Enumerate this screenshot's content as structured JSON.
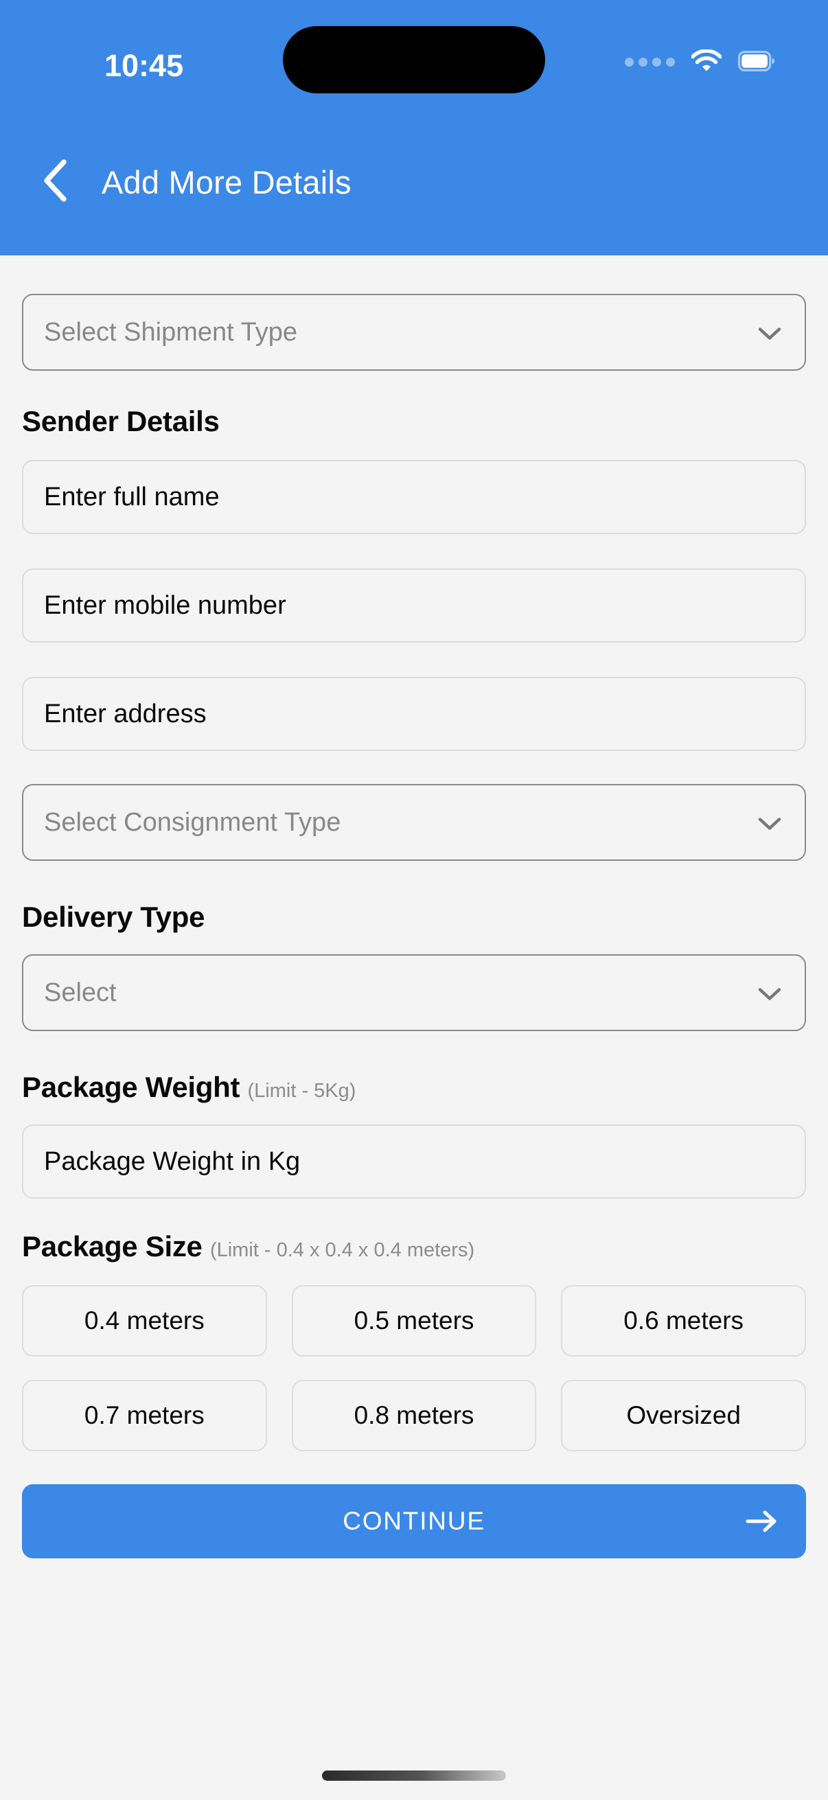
{
  "status_bar": {
    "time": "10:45",
    "signal_icon": "signal-dots-icon",
    "wifi_icon": "wifi-icon",
    "battery_icon": "battery-full-icon"
  },
  "header": {
    "back_icon": "chevron-left-icon",
    "title": "Add More Details",
    "background_color": "#3b88e6"
  },
  "form": {
    "shipment_type": {
      "placeholder": "Select Shipment Type",
      "icon": "chevron-down-icon"
    },
    "sender_details": {
      "heading": "Sender Details",
      "full_name_placeholder": "Enter full name",
      "mobile_placeholder": "Enter mobile number",
      "address_placeholder": "Enter address"
    },
    "consignment_type": {
      "placeholder": "Select Consignment Type",
      "icon": "chevron-down-icon"
    },
    "delivery_type": {
      "heading": "Delivery Type",
      "placeholder": "Select",
      "icon": "chevron-down-icon"
    },
    "package_weight": {
      "heading": "Package Weight",
      "limit": "(Limit - 5Kg)",
      "placeholder": "Package Weight in Kg"
    },
    "package_size": {
      "heading": "Package Size",
      "limit": "(Limit - 0.4 x 0.4 x 0.4 meters)",
      "options": [
        "0.4 meters",
        "0.5 meters",
        "0.6 meters",
        "0.7 meters",
        "0.8 meters",
        "Oversized"
      ]
    }
  },
  "footer": {
    "continue_label": "CONTINUE",
    "continue_icon": "arrow-right-icon",
    "accent_color": "#3b88e6"
  }
}
